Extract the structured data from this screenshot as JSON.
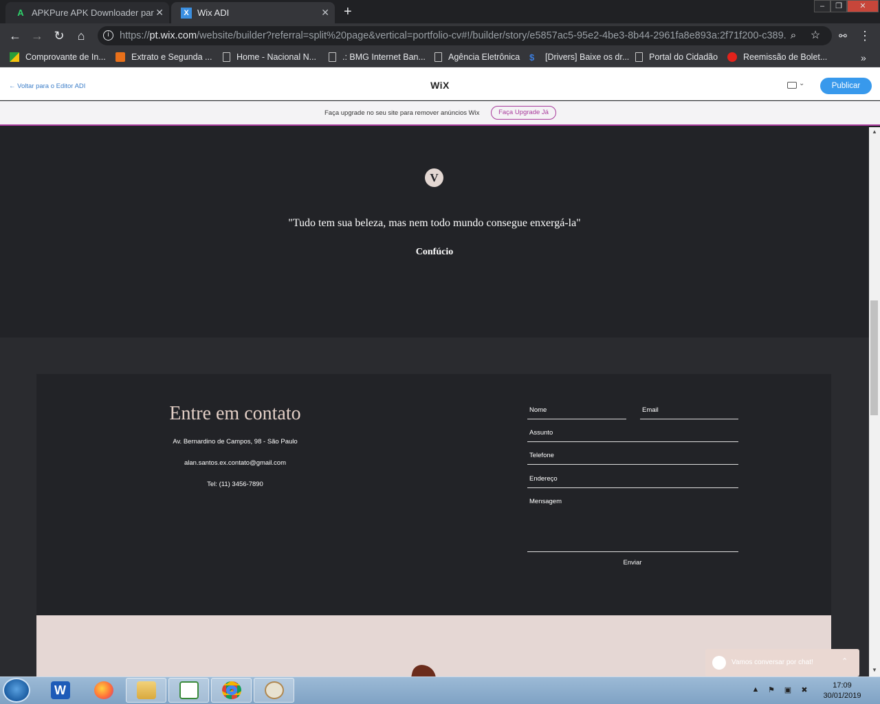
{
  "browser": {
    "tabs": [
      {
        "label": "APKPure APK Downloader para Android",
        "icon": "apkpure-icon",
        "active": false
      },
      {
        "label": "Wix ADI",
        "icon": "wix-icon",
        "active": true
      }
    ],
    "new_tab_label": "+",
    "url_host": "pt.wix.com",
    "url_prefix": "https://",
    "url_rest": "/website/builder?referral=split%20page&vertical=portfolio-cv#!/builder/story/e5857ac5-95e2-4be3-8b44-2961fa8e893a:2f71f200-c389...",
    "bookmarks": [
      {
        "label": "Comprovante de In...",
        "icon": "gov-flag-icon"
      },
      {
        "label": "Extrato e Segunda ...",
        "icon": "extrato-icon"
      },
      {
        "label": "Home - Nacional N...",
        "icon": "page-icon"
      },
      {
        "label": ".: BMG Internet Ban...",
        "icon": "page-icon"
      },
      {
        "label": "Agência Eletrônica",
        "icon": "page-icon"
      },
      {
        "label": "[Drivers] Baixe os dr...",
        "icon": "dollar-icon"
      },
      {
        "label": "Portal do Cidadão",
        "icon": "page-icon"
      },
      {
        "label": "Reemissão de Bolet...",
        "icon": "santander-icon"
      }
    ],
    "bookmarks_more": "»"
  },
  "wix_header": {
    "back_label": "Voltar para o Editor ADI",
    "logo": "WiX",
    "publish_label": "Publicar"
  },
  "upgrade_banner": {
    "text": "Faça upgrade no seu site para remover anúncios Wix",
    "button_label": "Faça Upgrade Já"
  },
  "quote_section": {
    "logo_letter": "V",
    "quote": "\"Tudo tem sua beleza, mas nem todo mundo consegue enxergá-la\"",
    "author": "Confúcio"
  },
  "contact": {
    "title": "Entre em contato",
    "address": "Av. Bernardino de Campos, 98 - São Paulo",
    "email": "alan.santos.ex.contato@gmail.com",
    "phone": "Tel: (11) 3456-7890",
    "form": {
      "name_label": "Nome",
      "email_label": "Email",
      "subject_label": "Assunto",
      "phone_label": "Telefone",
      "address_label": "Endereço",
      "message_label": "Mensagem",
      "submit_label": "Enviar"
    }
  },
  "chat_widget": {
    "text": "Vamos conversar por chat!"
  },
  "taskbar": {
    "apps": [
      "word-icon",
      "firefox-icon",
      "file-explorer-icon",
      "planner-icon",
      "chrome-icon",
      "paint-icon"
    ],
    "time": "17:09",
    "date": "30/01/2019"
  },
  "colors": {
    "accent_blue": "#3899ec",
    "upgrade_purple": "#a83a9b",
    "dark_bg": "#222327",
    "title_pink": "#e3cfc6"
  }
}
